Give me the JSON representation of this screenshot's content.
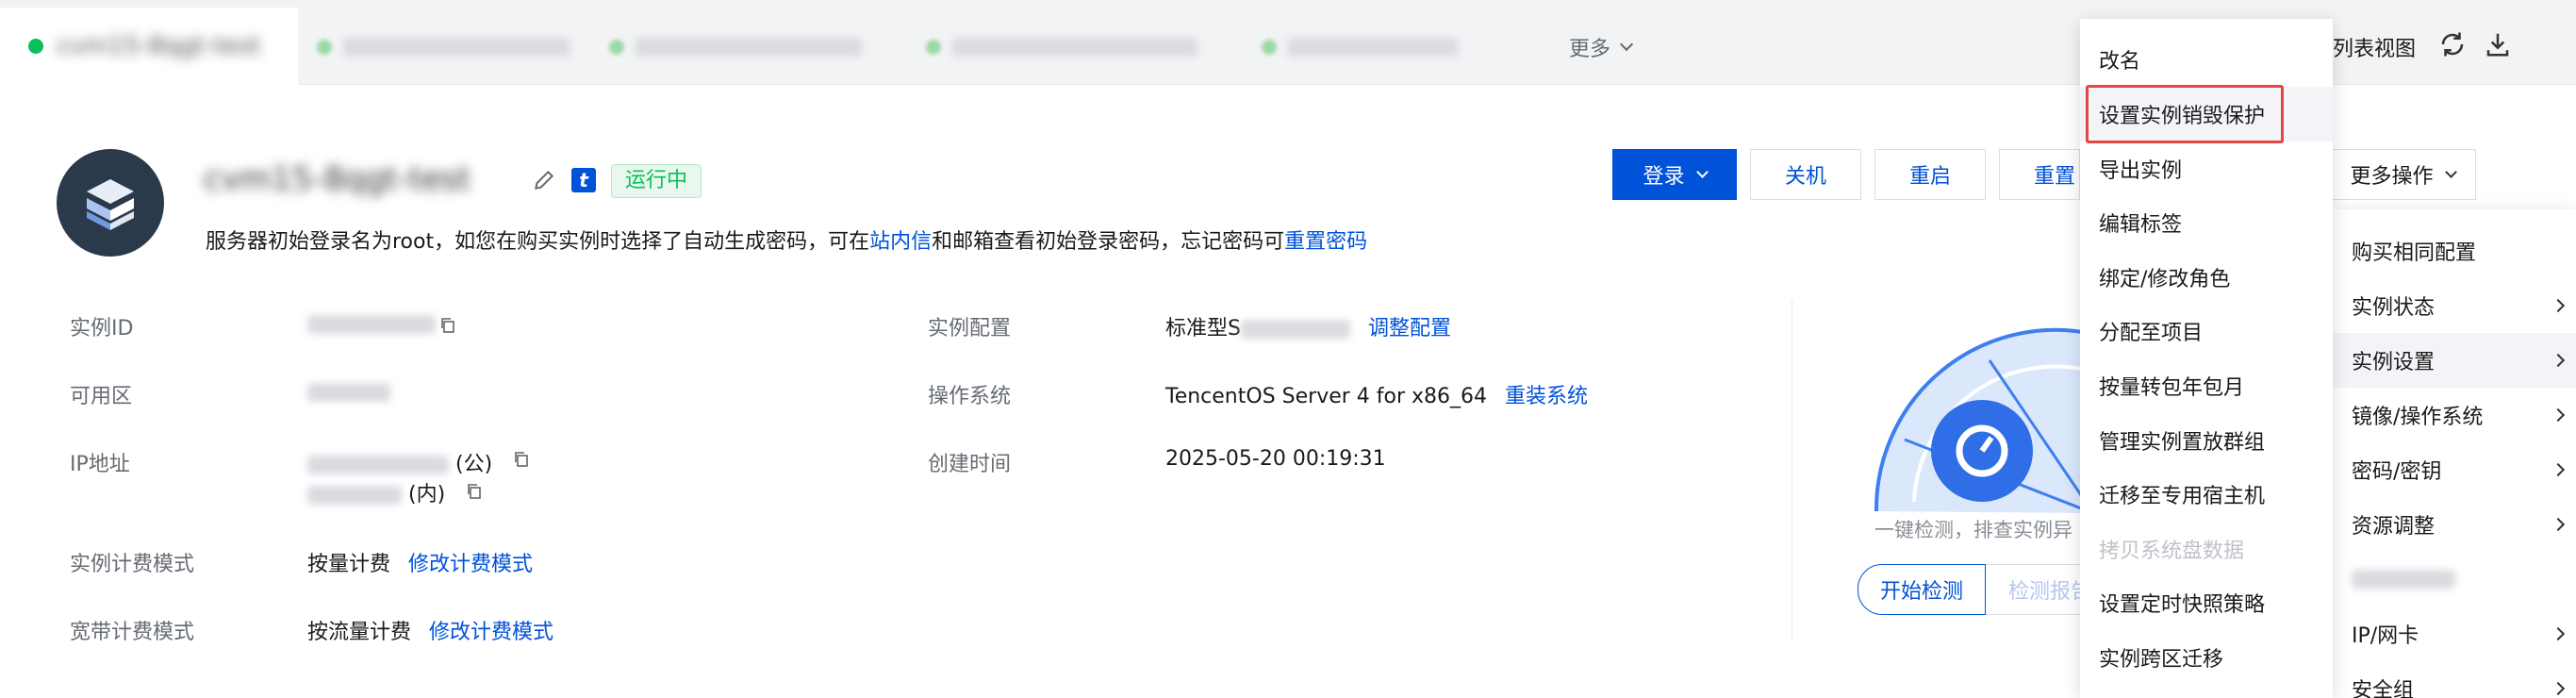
{
  "tabs": {
    "more_label": "更多",
    "list_view_label": "列表视图"
  },
  "header": {
    "status_badge": "运行中",
    "t_badge": "t",
    "tip_prefix": "服务器初始登录名为root，如您在购买实例时选择了自动生成密码，可在",
    "tip_link1": "站内信",
    "tip_middle": "和邮箱查看初始登录密码，忘记密码可",
    "tip_link2": "重置密码"
  },
  "toolbar": {
    "login": "登录",
    "shutdown": "关机",
    "restart": "重启",
    "reset": "重置",
    "more_ops": "更多操作"
  },
  "details": {
    "instance_id_label": "实例ID",
    "zone_label": "可用区",
    "ip_label": "IP地址",
    "ip_public_suffix": "(公)",
    "ip_private_suffix": "(内)",
    "billing_label": "实例计费模式",
    "billing_value": "按量计费",
    "billing_link": "修改计费模式",
    "bandwidth_label": "宽带计费模式",
    "bandwidth_value": "按流量计费",
    "bandwidth_link": "修改计费模式",
    "config_label": "实例配置",
    "config_value": "标准型S",
    "config_link": "调整配置",
    "os_label": "操作系统",
    "os_value": "TencentOS Server 4 for x86_64",
    "os_link": "重装系统",
    "created_label": "创建时间",
    "created_value": "2025-05-20 00:19:31"
  },
  "health": {
    "desc": "一键检测，排查实例异",
    "start": "开始检测",
    "report": "检测报告"
  },
  "submenu": {
    "items": [
      "改名",
      "设置实例销毁保护",
      "导出实例",
      "编辑标签",
      "绑定/修改角色",
      "分配至项目",
      "按量转包年包月",
      "管理实例置放群组",
      "迁移至专用宿主机",
      "拷贝系统盘数据",
      "设置定时快照策略",
      "实例跨区迁移"
    ]
  },
  "mainmenu": {
    "items": [
      "购买相同配置",
      "实例状态",
      "实例设置",
      "镜像/操作系统",
      "密码/密钥",
      "资源调整",
      "IP/网卡",
      "安全组"
    ]
  },
  "colors": {
    "primary": "#0052d9",
    "running_green": "#0abf5b",
    "highlight_red": "#e54545"
  }
}
